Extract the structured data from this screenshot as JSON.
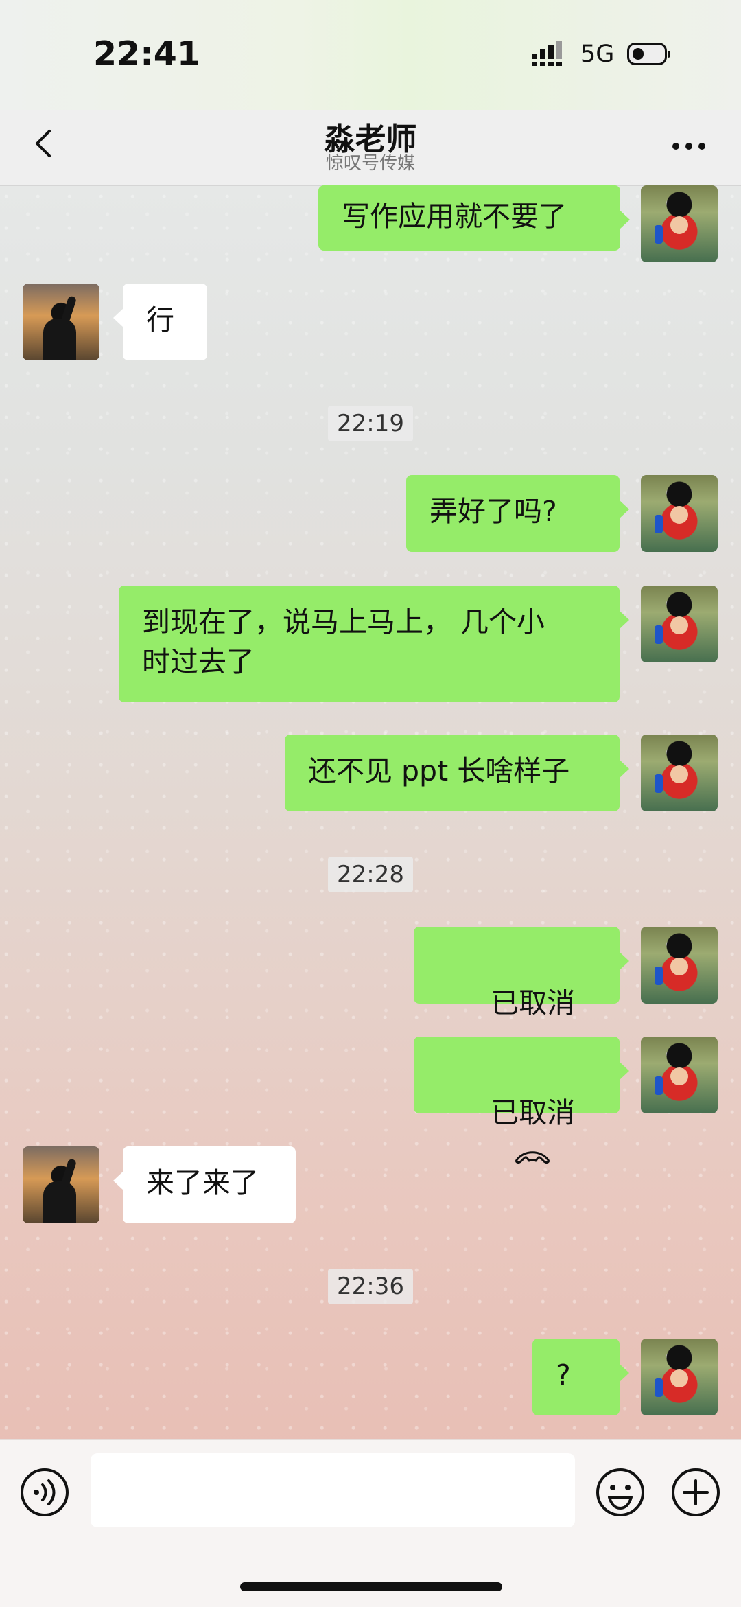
{
  "status": {
    "time": "22:41",
    "network": "5G"
  },
  "header": {
    "title": "淼老师",
    "subtitle": "惊叹号传媒"
  },
  "messages": [
    {
      "type": "outgoing",
      "text": "写作应用就不要了"
    },
    {
      "type": "incoming",
      "text": "行"
    },
    {
      "type": "time",
      "text": "22:19"
    },
    {
      "type": "outgoing",
      "text": "弄好了吗?"
    },
    {
      "type": "outgoing",
      "text": "到现在了，说马上马上， 几个小\n时过去了"
    },
    {
      "type": "outgoing",
      "text": "还不见 ppt 长啥样子"
    },
    {
      "type": "time",
      "text": "22:28"
    },
    {
      "type": "outgoing",
      "text": "已取消"
    },
    {
      "type": "outgoing",
      "text": "已取消"
    },
    {
      "type": "incoming",
      "text": "来了来了"
    },
    {
      "type": "time",
      "text": "22:36"
    },
    {
      "type": "outgoing",
      "text": "?"
    }
  ],
  "colors": {
    "outgoing_bubble": "#95ec69",
    "incoming_bubble": "#ffffff"
  },
  "icons": {
    "back": "chevron-left-icon",
    "more": "more-icon",
    "voice": "voice-icon",
    "emoji": "emoji-icon",
    "plus": "plus-icon",
    "call": "phone-icon"
  }
}
